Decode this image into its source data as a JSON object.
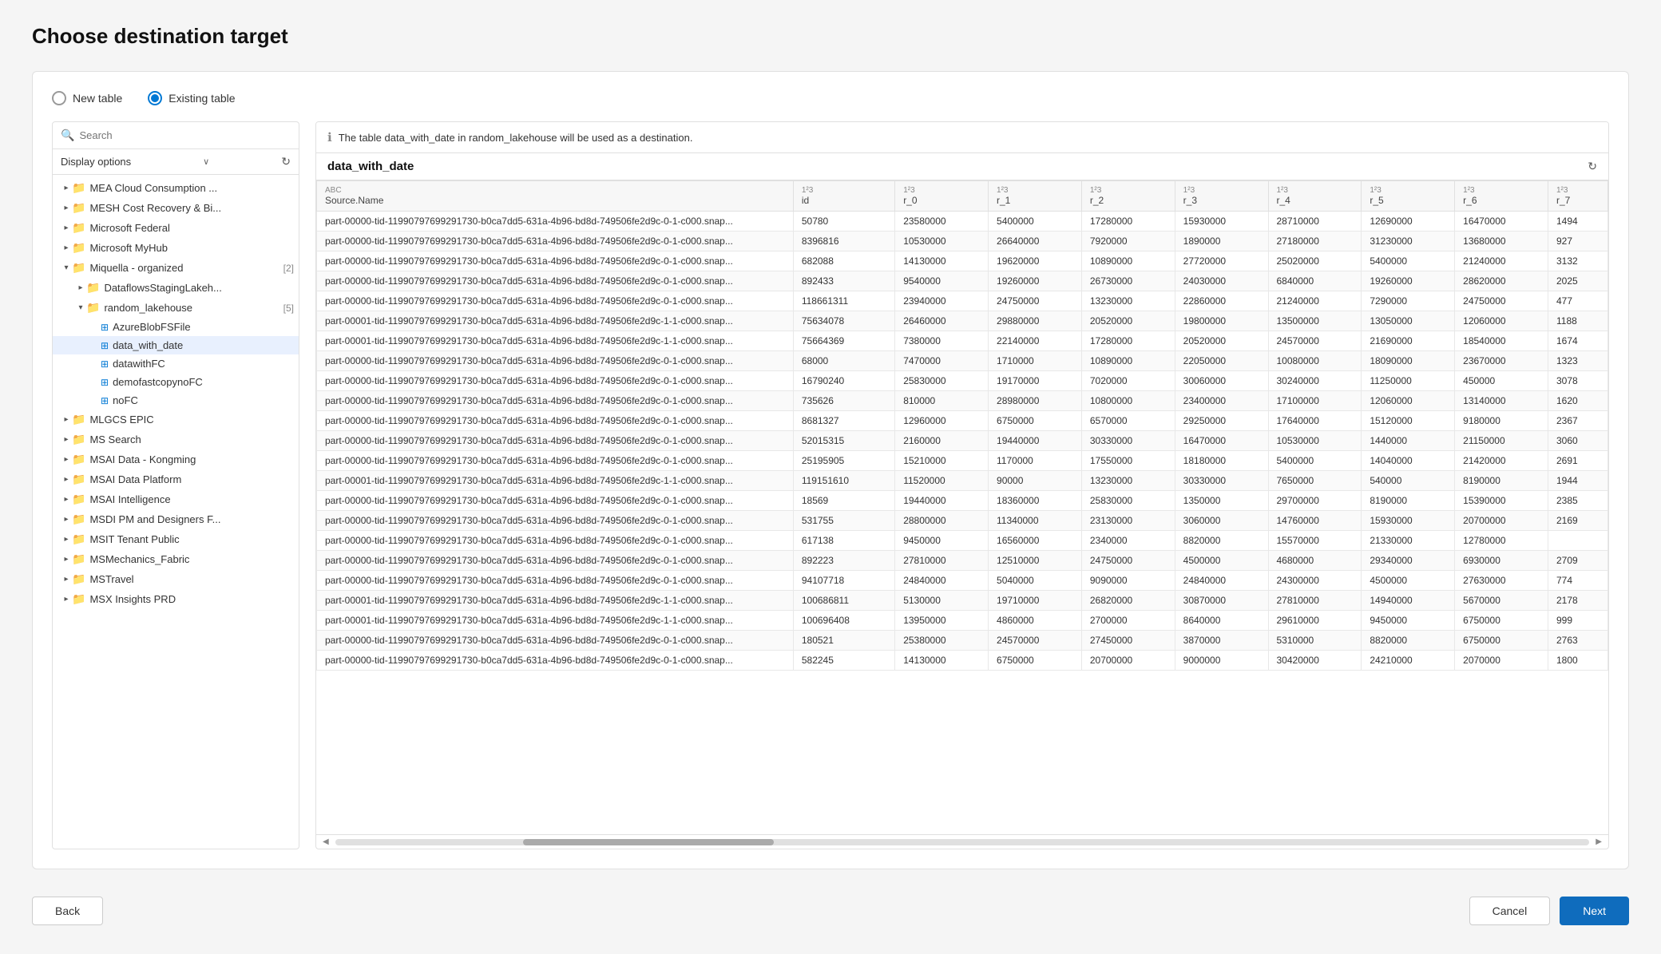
{
  "page": {
    "title": "Choose destination target"
  },
  "radio": {
    "new_table_label": "New table",
    "existing_table_label": "Existing table"
  },
  "left_panel": {
    "search_placeholder": "Search",
    "display_options_label": "Display options",
    "tree_items": [
      {
        "id": "mea",
        "label": "MEA Cloud Consumption ...",
        "type": "folder",
        "level": 0,
        "expanded": false
      },
      {
        "id": "mesh",
        "label": "MESH Cost Recovery & Bi...",
        "type": "folder",
        "level": 0,
        "expanded": false
      },
      {
        "id": "msfederal",
        "label": "Microsoft Federal",
        "type": "folder",
        "level": 0,
        "expanded": false
      },
      {
        "id": "myhub",
        "label": "Microsoft MyHub",
        "type": "folder",
        "level": 0,
        "expanded": false
      },
      {
        "id": "miquella",
        "label": "Miquella - organized",
        "type": "folder",
        "level": 0,
        "expanded": true,
        "count": 2
      },
      {
        "id": "dataflows",
        "label": "DataflowsStagingLakeh...",
        "type": "folder",
        "level": 1,
        "expanded": false
      },
      {
        "id": "random_lakehouse",
        "label": "random_lakehouse",
        "type": "folder",
        "level": 1,
        "expanded": true,
        "count": 5
      },
      {
        "id": "azureblob",
        "label": "AzureBlobFSFile",
        "type": "table",
        "level": 2
      },
      {
        "id": "data_with_date",
        "label": "data_with_date",
        "type": "table",
        "level": 2,
        "selected": true
      },
      {
        "id": "datawithfc",
        "label": "datawithFC",
        "type": "table",
        "level": 2
      },
      {
        "id": "demofastcopynofc",
        "label": "demofastcopynoFC",
        "type": "table",
        "level": 2
      },
      {
        "id": "nofc",
        "label": "noFC",
        "type": "table",
        "level": 2
      },
      {
        "id": "mlgcs",
        "label": "MLGCS EPIC",
        "type": "folder",
        "level": 0,
        "expanded": false
      },
      {
        "id": "mssearch",
        "label": "MS Search",
        "type": "folder",
        "level": 0,
        "expanded": false
      },
      {
        "id": "msai_kongming",
        "label": "MSAI Data - Kongming",
        "type": "folder",
        "level": 0,
        "expanded": false
      },
      {
        "id": "msai_platform",
        "label": "MSAI Data Platform",
        "type": "folder",
        "level": 0,
        "expanded": false
      },
      {
        "id": "msai_intelligence",
        "label": "MSAI Intelligence",
        "type": "folder",
        "level": 0,
        "expanded": false
      },
      {
        "id": "msdi_pm",
        "label": "MSDI PM and Designers F...",
        "type": "folder",
        "level": 0,
        "expanded": false
      },
      {
        "id": "msit_tenant",
        "label": "MSIT Tenant Public",
        "type": "folder",
        "level": 0,
        "expanded": false
      },
      {
        "id": "msmechanics",
        "label": "MSMechanics_Fabric",
        "type": "folder",
        "level": 0,
        "expanded": false
      },
      {
        "id": "mstravel",
        "label": "MSTravel",
        "type": "folder",
        "level": 0,
        "expanded": false
      },
      {
        "id": "msx_insights",
        "label": "MSX Insights PRD",
        "type": "folder",
        "level": 0,
        "expanded": false
      }
    ]
  },
  "right_panel": {
    "info_text": "The table data_with_date in random_lakehouse will be used as a destination.",
    "table_name": "data_with_date",
    "columns": [
      {
        "name": "Source.Name",
        "type": "ABC"
      },
      {
        "name": "id",
        "type": "123"
      },
      {
        "name": "r_0",
        "type": "123"
      },
      {
        "name": "r_1",
        "type": "123"
      },
      {
        "name": "r_2",
        "type": "123"
      },
      {
        "name": "r_3",
        "type": "123"
      },
      {
        "name": "r_4",
        "type": "123"
      },
      {
        "name": "r_5",
        "type": "123"
      },
      {
        "name": "r_6",
        "type": "123"
      },
      {
        "name": "r_7",
        "type": "123"
      }
    ],
    "rows": [
      [
        "part-00000-tid-11990797699291730-b0ca7dd5-631a-4b96-bd8d-749506fe2d9c-0-1-c000.snap...",
        "50780",
        "23580000",
        "5400000",
        "17280000",
        "15930000",
        "28710000",
        "12690000",
        "16470000",
        "1494"
      ],
      [
        "part-00000-tid-11990797699291730-b0ca7dd5-631a-4b96-bd8d-749506fe2d9c-0-1-c000.snap...",
        "8396816",
        "10530000",
        "26640000",
        "7920000",
        "1890000",
        "27180000",
        "31230000",
        "13680000",
        "927"
      ],
      [
        "part-00000-tid-11990797699291730-b0ca7dd5-631a-4b96-bd8d-749506fe2d9c-0-1-c000.snap...",
        "682088",
        "14130000",
        "19620000",
        "10890000",
        "27720000",
        "25020000",
        "5400000",
        "21240000",
        "3132"
      ],
      [
        "part-00000-tid-11990797699291730-b0ca7dd5-631a-4b96-bd8d-749506fe2d9c-0-1-c000.snap...",
        "892433",
        "9540000",
        "19260000",
        "26730000",
        "24030000",
        "6840000",
        "19260000",
        "28620000",
        "2025"
      ],
      [
        "part-00000-tid-11990797699291730-b0ca7dd5-631a-4b96-bd8d-749506fe2d9c-0-1-c000.snap...",
        "118661311",
        "23940000",
        "24750000",
        "13230000",
        "22860000",
        "21240000",
        "7290000",
        "24750000",
        "477"
      ],
      [
        "part-00001-tid-11990797699291730-b0ca7dd5-631a-4b96-bd8d-749506fe2d9c-1-1-c000.snap...",
        "75634078",
        "26460000",
        "29880000",
        "20520000",
        "19800000",
        "13500000",
        "13050000",
        "12060000",
        "1188"
      ],
      [
        "part-00001-tid-11990797699291730-b0ca7dd5-631a-4b96-bd8d-749506fe2d9c-1-1-c000.snap...",
        "75664369",
        "7380000",
        "22140000",
        "17280000",
        "20520000",
        "24570000",
        "21690000",
        "18540000",
        "1674"
      ],
      [
        "part-00000-tid-11990797699291730-b0ca7dd5-631a-4b96-bd8d-749506fe2d9c-0-1-c000.snap...",
        "68000",
        "7470000",
        "1710000",
        "10890000",
        "22050000",
        "10080000",
        "18090000",
        "23670000",
        "1323"
      ],
      [
        "part-00000-tid-11990797699291730-b0ca7dd5-631a-4b96-bd8d-749506fe2d9c-0-1-c000.snap...",
        "16790240",
        "25830000",
        "19170000",
        "7020000",
        "30060000",
        "30240000",
        "11250000",
        "450000",
        "3078"
      ],
      [
        "part-00000-tid-11990797699291730-b0ca7dd5-631a-4b96-bd8d-749506fe2d9c-0-1-c000.snap...",
        "735626",
        "810000",
        "28980000",
        "10800000",
        "23400000",
        "17100000",
        "12060000",
        "13140000",
        "1620"
      ],
      [
        "part-00000-tid-11990797699291730-b0ca7dd5-631a-4b96-bd8d-749506fe2d9c-0-1-c000.snap...",
        "8681327",
        "12960000",
        "6750000",
        "6570000",
        "29250000",
        "17640000",
        "15120000",
        "9180000",
        "2367"
      ],
      [
        "part-00000-tid-11990797699291730-b0ca7dd5-631a-4b96-bd8d-749506fe2d9c-0-1-c000.snap...",
        "52015315",
        "2160000",
        "19440000",
        "30330000",
        "16470000",
        "10530000",
        "1440000",
        "21150000",
        "3060"
      ],
      [
        "part-00000-tid-11990797699291730-b0ca7dd5-631a-4b96-bd8d-749506fe2d9c-0-1-c000.snap...",
        "25195905",
        "15210000",
        "1170000",
        "17550000",
        "18180000",
        "5400000",
        "14040000",
        "21420000",
        "2691"
      ],
      [
        "part-00001-tid-11990797699291730-b0ca7dd5-631a-4b96-bd8d-749506fe2d9c-1-1-c000.snap...",
        "119151610",
        "11520000",
        "90000",
        "13230000",
        "30330000",
        "7650000",
        "540000",
        "8190000",
        "1944"
      ],
      [
        "part-00000-tid-11990797699291730-b0ca7dd5-631a-4b96-bd8d-749506fe2d9c-0-1-c000.snap...",
        "18569",
        "19440000",
        "18360000",
        "25830000",
        "1350000",
        "29700000",
        "8190000",
        "15390000",
        "2385"
      ],
      [
        "part-00000-tid-11990797699291730-b0ca7dd5-631a-4b96-bd8d-749506fe2d9c-0-1-c000.snap...",
        "531755",
        "28800000",
        "11340000",
        "23130000",
        "3060000",
        "14760000",
        "15930000",
        "20700000",
        "2169"
      ],
      [
        "part-00000-tid-11990797699291730-b0ca7dd5-631a-4b96-bd8d-749506fe2d9c-0-1-c000.snap...",
        "617138",
        "9450000",
        "16560000",
        "2340000",
        "8820000",
        "15570000",
        "21330000",
        "12780000",
        ""
      ],
      [
        "part-00000-tid-11990797699291730-b0ca7dd5-631a-4b96-bd8d-749506fe2d9c-0-1-c000.snap...",
        "892223",
        "27810000",
        "12510000",
        "24750000",
        "4500000",
        "4680000",
        "29340000",
        "6930000",
        "2709"
      ],
      [
        "part-00000-tid-11990797699291730-b0ca7dd5-631a-4b96-bd8d-749506fe2d9c-0-1-c000.snap...",
        "94107718",
        "24840000",
        "5040000",
        "9090000",
        "24840000",
        "24300000",
        "4500000",
        "27630000",
        "774"
      ],
      [
        "part-00001-tid-11990797699291730-b0ca7dd5-631a-4b96-bd8d-749506fe2d9c-1-1-c000.snap...",
        "100686811",
        "5130000",
        "19710000",
        "26820000",
        "30870000",
        "27810000",
        "14940000",
        "5670000",
        "2178"
      ],
      [
        "part-00001-tid-11990797699291730-b0ca7dd5-631a-4b96-bd8d-749506fe2d9c-1-1-c000.snap...",
        "100696408",
        "13950000",
        "4860000",
        "2700000",
        "8640000",
        "29610000",
        "9450000",
        "6750000",
        "999"
      ],
      [
        "part-00000-tid-11990797699291730-b0ca7dd5-631a-4b96-bd8d-749506fe2d9c-0-1-c000.snap...",
        "180521",
        "25380000",
        "24570000",
        "27450000",
        "3870000",
        "5310000",
        "8820000",
        "6750000",
        "2763"
      ],
      [
        "part-00000-tid-11990797699291730-b0ca7dd5-631a-4b96-bd8d-749506fe2d9c-0-1-c000.snap...",
        "582245",
        "14130000",
        "6750000",
        "20700000",
        "9000000",
        "30420000",
        "24210000",
        "2070000",
        "1800"
      ]
    ]
  },
  "footer": {
    "back_label": "Back",
    "cancel_label": "Cancel",
    "next_label": "Next"
  }
}
